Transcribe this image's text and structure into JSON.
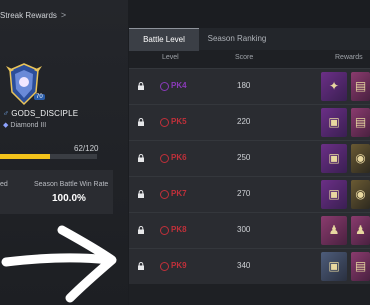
{
  "header": {
    "streak_rewards": "Streak Rewards"
  },
  "player": {
    "rank_number": "70",
    "name": "GODS_DISCIPLE",
    "tier": "Diamond III",
    "progress_text": "62/120",
    "progress_fraction": 0.517
  },
  "stats": {
    "left_label": "ed",
    "win_rate_label": "Season Battle Win Rate",
    "win_rate_value": "100.0%"
  },
  "tabs": [
    {
      "label": "Battle Level",
      "active": true
    },
    {
      "label": "Season Ranking",
      "active": false
    }
  ],
  "columns": {
    "level": "Level",
    "score": "Score",
    "rewards": "Rewards"
  },
  "rows": [
    {
      "level": "PK4",
      "score": "180",
      "color": "#8a3ab8"
    },
    {
      "level": "PK5",
      "score": "220",
      "color": "#c0303a"
    },
    {
      "level": "PK6",
      "score": "250",
      "color": "#c0303a"
    },
    {
      "level": "PK7",
      "score": "270",
      "color": "#c0303a"
    },
    {
      "level": "PK8",
      "score": "300",
      "color": "#c0303a"
    },
    {
      "level": "PK9",
      "score": "340",
      "color": "#c0303a"
    }
  ],
  "colors": {
    "accent_yellow": "#f3c21b",
    "pk_red": "#c0303a",
    "pk_purple": "#8a3ab8"
  }
}
